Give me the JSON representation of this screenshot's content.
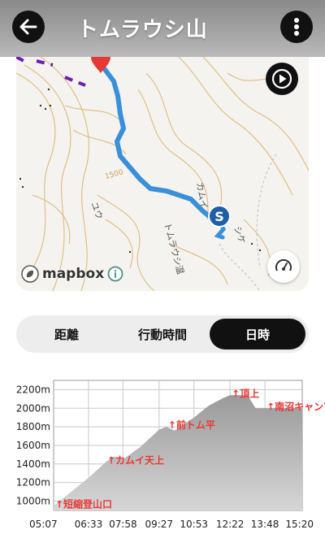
{
  "header": {
    "title": "トムラウシ山",
    "back_icon": "arrow-left-icon",
    "menu_icon": "more-vertical-icon"
  },
  "map": {
    "attribution": "mapbox",
    "labels": [
      "1500",
      "カムイ",
      "ユウ",
      "トムラウシ温",
      "シケ"
    ],
    "start_marker": "S",
    "play_icon": "play-icon",
    "speed_icon": "speedometer-icon",
    "route_color": "#3a8fd9"
  },
  "tabs": {
    "distance": "距離",
    "time": "行動時間",
    "date": "日時",
    "selected": "日時"
  },
  "chart_data": {
    "type": "area",
    "x_ticks": [
      "05:07",
      "06:33",
      "07:58",
      "09:27",
      "10:53",
      "12:22",
      "13:48",
      "15:20"
    ],
    "y_ticks": [
      "1000m",
      "1200m",
      "1400m",
      "1600m",
      "1800m",
      "2000m",
      "2200m"
    ],
    "ylim": [
      900,
      2300
    ],
    "x": [
      "05:07",
      "05:50",
      "06:33",
      "07:15",
      "07:35",
      "07:50",
      "07:58",
      "08:40",
      "09:27",
      "09:45",
      "10:05",
      "10:53",
      "11:30",
      "12:05",
      "12:22",
      "12:45",
      "13:05",
      "13:25",
      "13:48",
      "14:30",
      "15:20"
    ],
    "y": [
      950,
      1100,
      1250,
      1420,
      1480,
      1470,
      1450,
      1580,
      1770,
      1800,
      1760,
      1900,
      2030,
      2110,
      2140,
      2140,
      2140,
      2000,
      2000,
      2000,
      2000
    ],
    "annotations": [
      {
        "label": "短縮登山口",
        "x": "05:07",
        "y": 950
      },
      {
        "label": "カムイ天上",
        "x": "07:15",
        "y": 1420
      },
      {
        "label": "前トム平",
        "x": "09:45",
        "y": 1800
      },
      {
        "label": "頂上",
        "x": "12:22",
        "y": 2140
      },
      {
        "label": "南沼キャンプ",
        "x": "13:48",
        "y": 2000
      }
    ],
    "fill_color": "#9a9a9a",
    "annotation_color": "#e53935",
    "grid": true
  }
}
